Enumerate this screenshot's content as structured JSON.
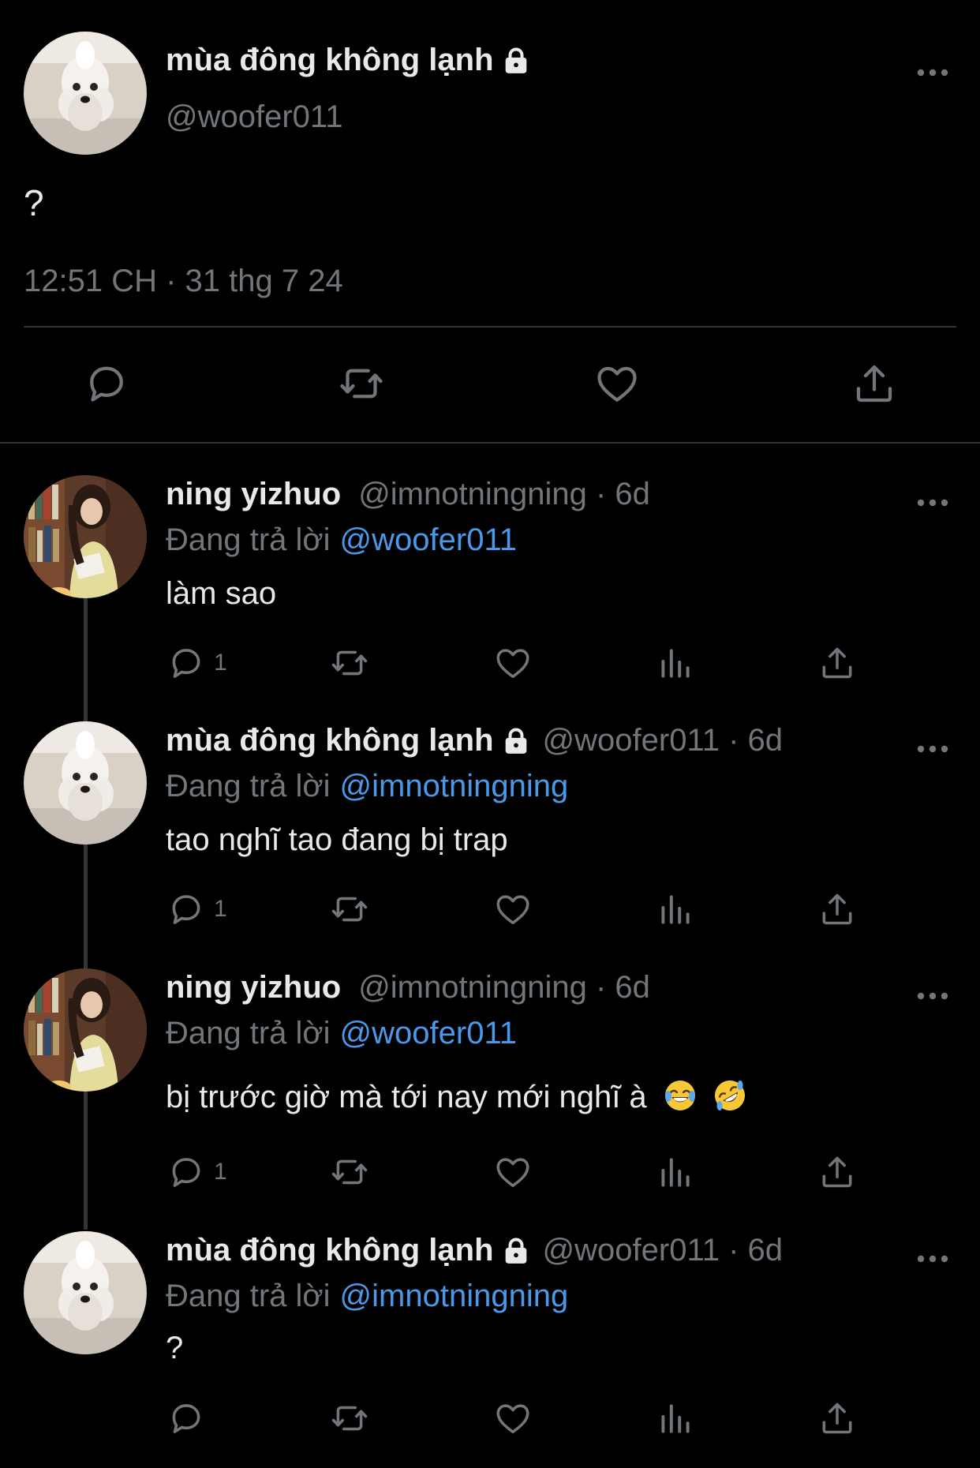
{
  "main_tweet": {
    "display_name": "mùa đông không lạnh",
    "handle": "@woofer011",
    "text": "?",
    "timestamp": "12:51 CH · 31 thg 7 24",
    "locked": true,
    "icons": [
      "reply-icon",
      "retweet-icon",
      "like-icon",
      "share-icon",
      "more-icon",
      "lock-icon"
    ]
  },
  "replying_label": "Đang trả lời",
  "replies": [
    {
      "display_name": "ning yizhuo",
      "meta": "@imnotningning · 6d",
      "replying_to": "@woofer011",
      "text": "làm sao",
      "reply_count": "1",
      "locked": false
    },
    {
      "display_name": "mùa đông không lạnh",
      "meta": "@woofer011 · 6d",
      "replying_to": "@imnotningning",
      "text": "tao nghĩ tao đang bị trap",
      "reply_count": "1",
      "locked": true
    },
    {
      "display_name": "ning yizhuo",
      "meta": "@imnotningning · 6d",
      "replying_to": "@woofer011",
      "text": "bị trước giờ mà tới nay mới nghĩ à",
      "emojis": [
        "face-with-tears-of-joy",
        "rolling-on-floor-laughing"
      ],
      "reply_count": "1",
      "locked": false
    },
    {
      "display_name": "mùa đông không lạnh",
      "meta": "@woofer011 · 6d",
      "replying_to": "@imnotningning",
      "text": "?",
      "reply_count": "",
      "locked": true
    }
  ],
  "colors": {
    "background": "#000000",
    "primary_text": "#e7e9ea",
    "secondary_text": "#71767b",
    "mention": "#4a99e9",
    "divider": "#2f3336"
  }
}
